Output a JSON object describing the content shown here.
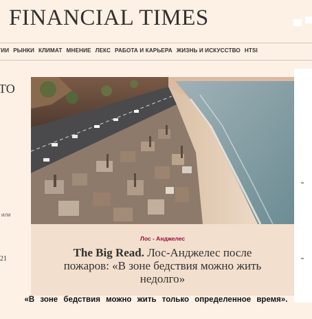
{
  "masthead": {
    "logo_text": "FINANCIAL TIMES"
  },
  "nav": {
    "items": [
      {
        "label": "ОГИИ"
      },
      {
        "label": "РЫНКИ"
      },
      {
        "label": "КЛИМАТ"
      },
      {
        "label": "МНЕНИЕ"
      },
      {
        "label": "ЛЕКС"
      },
      {
        "label": "РАБОТА И КАРЬЕРА"
      },
      {
        "label": "ЖИЗНЬ И ИСКУССТВО"
      },
      {
        "label": "HTSI"
      }
    ]
  },
  "left_column": {
    "fragment_top": "ТО",
    "fragment_mid": "или",
    "fragment_bottom": "21"
  },
  "article": {
    "image_alt": "Burned coastal neighborhood along the Pacific highway",
    "tag": "Лос - Анджелес",
    "headline_prefix": "The Big Read.",
    "headline_rest": " Лос-Анджелес после пожаров: «В зоне бедствия можно жить недолго»"
  },
  "caption": {
    "text": "«В зоне бедствия можно жить только определенное время»."
  },
  "colors": {
    "page_bg": "#fdf1e6",
    "card_bg": "#f2dfce",
    "tag": "#990f3d",
    "text": "#33302e"
  }
}
